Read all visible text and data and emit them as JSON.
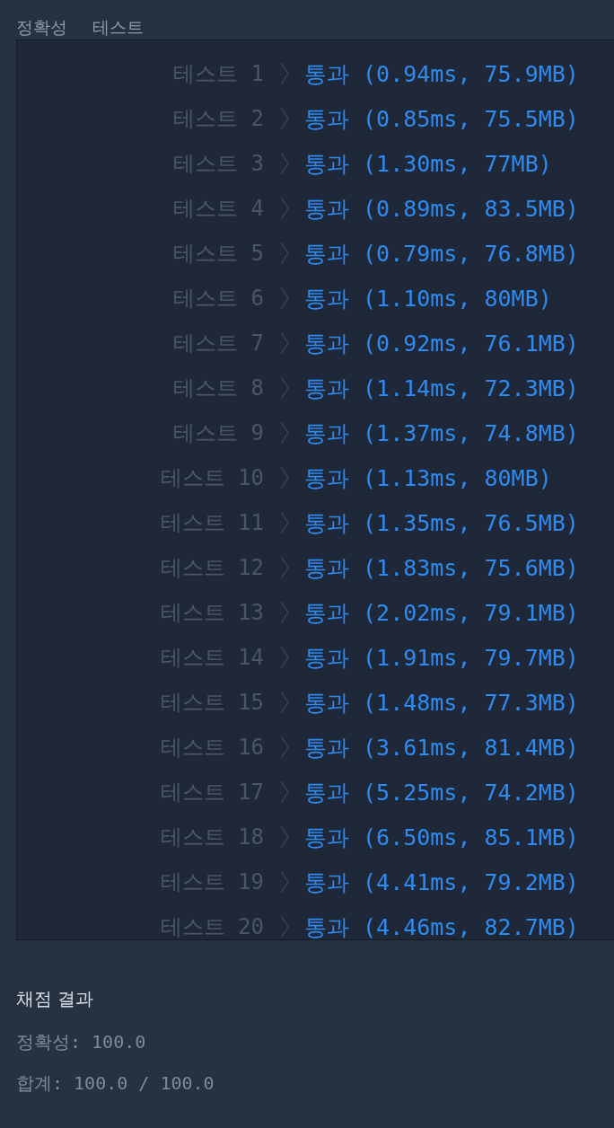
{
  "header": {
    "labels": [
      "정확성",
      "테스트"
    ]
  },
  "tests": [
    {
      "label": "테스트 1",
      "passed": true,
      "result": "통과 (0.94ms, 75.9MB)"
    },
    {
      "label": "테스트 2",
      "passed": true,
      "result": "통과 (0.85ms, 75.5MB)"
    },
    {
      "label": "테스트 3",
      "passed": true,
      "result": "통과 (1.30ms, 77MB)"
    },
    {
      "label": "테스트 4",
      "passed": true,
      "result": "통과 (0.89ms, 83.5MB)"
    },
    {
      "label": "테스트 5",
      "passed": true,
      "result": "통과 (0.79ms, 76.8MB)"
    },
    {
      "label": "테스트 6",
      "passed": true,
      "result": "통과 (1.10ms, 80MB)"
    },
    {
      "label": "테스트 7",
      "passed": true,
      "result": "통과 (0.92ms, 76.1MB)"
    },
    {
      "label": "테스트 8",
      "passed": true,
      "result": "통과 (1.14ms, 72.3MB)"
    },
    {
      "label": "테스트 9",
      "passed": true,
      "result": "통과 (1.37ms, 74.8MB)"
    },
    {
      "label": "테스트 10",
      "passed": true,
      "result": "통과 (1.13ms, 80MB)"
    },
    {
      "label": "테스트 11",
      "passed": true,
      "result": "통과 (1.35ms, 76.5MB)"
    },
    {
      "label": "테스트 12",
      "passed": true,
      "result": "통과 (1.83ms, 75.6MB)"
    },
    {
      "label": "테스트 13",
      "passed": true,
      "result": "통과 (2.02ms, 79.1MB)"
    },
    {
      "label": "테스트 14",
      "passed": true,
      "result": "통과 (1.91ms, 79.7MB)"
    },
    {
      "label": "테스트 15",
      "passed": true,
      "result": "통과 (1.48ms, 77.3MB)"
    },
    {
      "label": "테스트 16",
      "passed": true,
      "result": "통과 (3.61ms, 81.4MB)"
    },
    {
      "label": "테스트 17",
      "passed": true,
      "result": "통과 (5.25ms, 74.2MB)"
    },
    {
      "label": "테스트 18",
      "passed": true,
      "result": "통과 (6.50ms, 85.1MB)"
    },
    {
      "label": "테스트 19",
      "passed": true,
      "result": "통과 (4.41ms, 79.2MB)"
    },
    {
      "label": "테스트 20",
      "passed": true,
      "result": "통과 (4.46ms, 82.7MB)"
    }
  ],
  "summary": {
    "title": "채점 결과",
    "lines": [
      "정확성: 100.0",
      "합계: 100.0 / 100.0"
    ]
  }
}
